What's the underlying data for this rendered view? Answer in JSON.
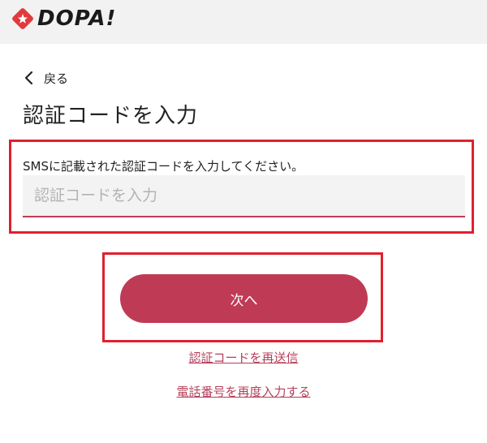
{
  "header": {
    "logo_text": "DOPA!",
    "logo_icon": "diamond-star-icon",
    "background": "#f2f2f2"
  },
  "nav": {
    "back_label": "戻る",
    "back_icon": "chevron-left-icon"
  },
  "page_title": "認証コードを入力",
  "form": {
    "instruction": "SMSに記載された認証コードを入力してください。",
    "code_placeholder": "認証コードを入力",
    "code_value": ""
  },
  "actions": {
    "next_label": "次へ",
    "resend_link": "認証コードを再送信",
    "reenter_phone_link": "電話番号を再度入力する"
  },
  "colors": {
    "accent": "#bf3b55",
    "link": "#b5405a",
    "highlight_frame": "#e0202e"
  }
}
